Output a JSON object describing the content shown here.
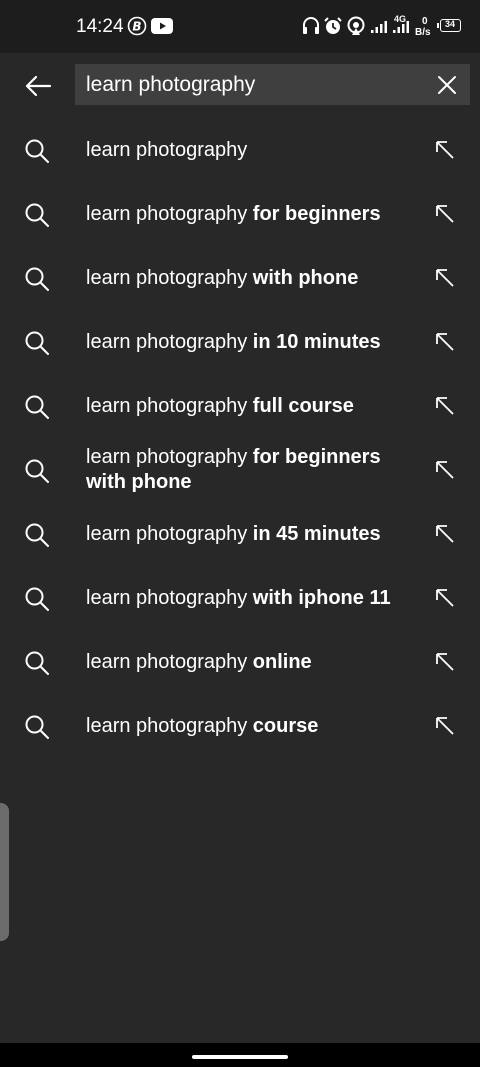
{
  "status_bar": {
    "time": "14:24",
    "network_type": "4G",
    "speed_value": "0",
    "speed_unit": "B/s",
    "battery": "34",
    "icons": [
      "bixby-icon",
      "youtube-icon",
      "headphones-icon",
      "alarm-icon",
      "hotspot-icon",
      "signal-icon",
      "signal-4g-icon",
      "battery-icon"
    ]
  },
  "search": {
    "query": "learn photography",
    "back_icon": "back-arrow-icon",
    "clear_icon": "close-icon"
  },
  "suggestions": [
    {
      "prefix": "learn photography",
      "completion": ""
    },
    {
      "prefix": "learn photography",
      "completion": " for beginners"
    },
    {
      "prefix": "learn photography",
      "completion": " with phone"
    },
    {
      "prefix": "learn photography",
      "completion": " in 10 minutes"
    },
    {
      "prefix": "learn photography",
      "completion": " full course"
    },
    {
      "prefix": "learn photography",
      "completion": " for beginners with phone"
    },
    {
      "prefix": "learn photography",
      "completion": " in 45 minutes"
    },
    {
      "prefix": "learn photography",
      "completion": " with iphone 11"
    },
    {
      "prefix": "learn photography",
      "completion": " online"
    },
    {
      "prefix": "learn photography",
      "completion": " course"
    }
  ],
  "colors": {
    "background": "#282828",
    "status_bar": "#1d1d1d",
    "search_box": "#3f3f3f",
    "text": "#ffffff"
  }
}
